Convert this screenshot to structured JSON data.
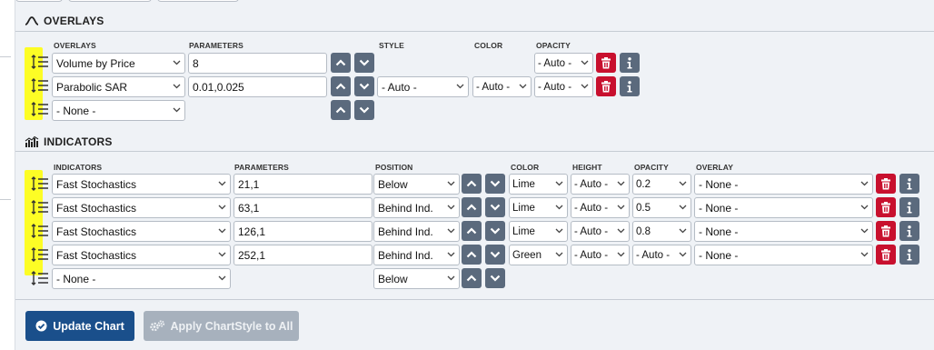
{
  "overlays": {
    "title": "OVERLAYS",
    "headers": {
      "name": "OVERLAYS",
      "parameters": "PARAMETERS",
      "style": "STYLE",
      "color": "COLOR",
      "opacity": "OPACITY"
    },
    "rows": [
      {
        "name": "Volume by Price",
        "parameters": "8",
        "style": "",
        "color": "",
        "opacity": "- Auto -"
      },
      {
        "name": "Parabolic SAR",
        "parameters": "0.01,0.025",
        "style": "- Auto -",
        "color": "- Auto -",
        "opacity": "- Auto -"
      },
      {
        "name": "- None -"
      }
    ]
  },
  "indicators": {
    "title": "INDICATORS",
    "headers": {
      "name": "INDICATORS",
      "parameters": "PARAMETERS",
      "position": "POSITION",
      "color": "COLOR",
      "height": "HEIGHT",
      "opacity": "OPACITY",
      "overlay": "OVERLAY"
    },
    "rows": [
      {
        "name": "Fast Stochastics",
        "parameters": "21,1",
        "position": "Below",
        "color": "Lime",
        "height": "- Auto -",
        "opacity": "0.2",
        "overlay": "- None -"
      },
      {
        "name": "Fast Stochastics",
        "parameters": "63,1",
        "position": "Behind Ind.",
        "color": "Lime",
        "height": "- Auto -",
        "opacity": "0.5",
        "overlay": "- None -"
      },
      {
        "name": "Fast Stochastics",
        "parameters": "126,1",
        "position": "Behind Ind.",
        "color": "Lime",
        "height": "- Auto -",
        "opacity": "0.8",
        "overlay": "- None -"
      },
      {
        "name": "Fast Stochastics",
        "parameters": "252,1",
        "position": "Behind Ind.",
        "color": "Green",
        "height": "- Auto -",
        "opacity": "- Auto -",
        "overlay": "- None -"
      },
      {
        "name": "- None -",
        "position": "Below"
      }
    ]
  },
  "actions": {
    "update": "Update Chart",
    "apply": "Apply ChartStyle to All"
  },
  "icons": {
    "section_overlays": "sine-wave-icon",
    "section_indicators": "bar-chart-icon",
    "drag": "drag-handle-icon",
    "move_up": "chevron-up-icon",
    "move_down": "chevron-down-icon",
    "delete": "trash-icon",
    "info": "info-icon",
    "update": "check-circle-icon",
    "apply": "gears-icon"
  },
  "colors": {
    "primary": "#1a4f8b",
    "danger": "#c8102e",
    "secondary": "#5b6a7d",
    "disabled": "#a7b1bd",
    "highlight": "#ffff00"
  }
}
